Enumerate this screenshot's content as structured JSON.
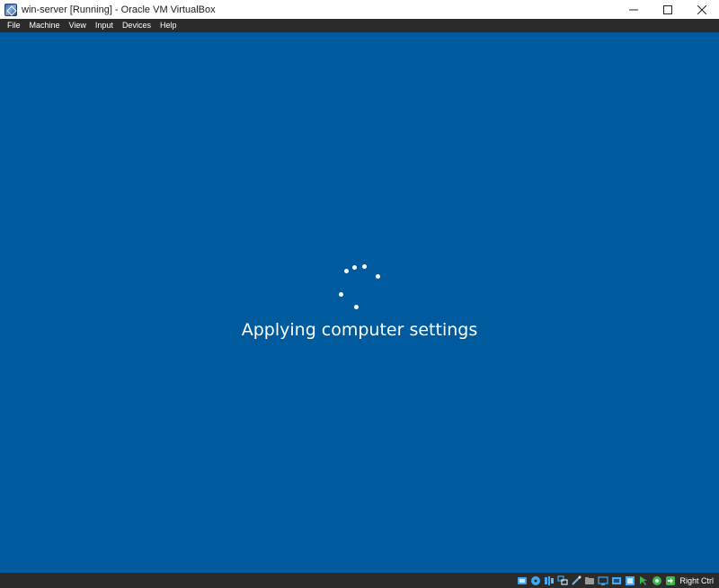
{
  "window": {
    "title": "win-server [Running] - Oracle VM VirtualBox",
    "controls": {
      "minimize_icon": "minimize-icon",
      "maximize_icon": "maximize-icon",
      "close_icon": "close-icon"
    }
  },
  "menubar": {
    "items": [
      {
        "label": "File"
      },
      {
        "label": "Machine"
      },
      {
        "label": "View"
      },
      {
        "label": "Input"
      },
      {
        "label": "Devices"
      },
      {
        "label": "Help"
      }
    ]
  },
  "guest": {
    "background_color": "#005a9e",
    "status_text": "Applying computer settings",
    "spinner_icon": "loading-spinner-icon"
  },
  "statusbar": {
    "icons": [
      {
        "name": "hard-disk-icon",
        "color": "#3fa9f5"
      },
      {
        "name": "optical-drive-icon",
        "color": "#3fa9f5"
      },
      {
        "name": "audio-icon",
        "color": "#3fa9f5"
      },
      {
        "name": "network-icon",
        "color": "#3fa9f5"
      },
      {
        "name": "usb-icon",
        "color": "#6fb8f0"
      },
      {
        "name": "shared-folders-icon",
        "color": "#9a9a9a"
      },
      {
        "name": "display-icon",
        "color": "#3fa9f5"
      },
      {
        "name": "recording-icon",
        "color": "#3fa9f5"
      },
      {
        "name": "cpu-icon",
        "color": "#3fa9f5"
      },
      {
        "name": "mouse-integration-icon",
        "color": "#3fb54a"
      },
      {
        "name": "keyboard-capture-icon",
        "color": "#3fb54a"
      },
      {
        "name": "host-key-arrow-icon",
        "color": "#3fb54a"
      }
    ],
    "host_key_label": "Right Ctrl"
  }
}
